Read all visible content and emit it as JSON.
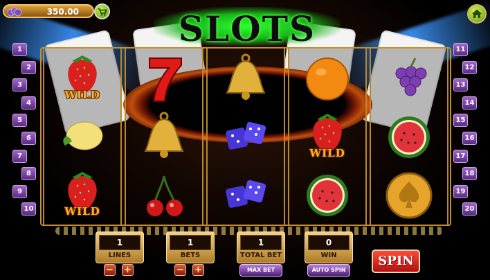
{
  "title": "SLOTS",
  "balance": {
    "coins": "350.00",
    "coin_icon": "coins-icon",
    "shop_icon": "cart-icon"
  },
  "home_icon": "home-icon",
  "line_buttons_left": [
    "1",
    "2",
    "3",
    "4",
    "5",
    "6",
    "7",
    "8",
    "9",
    "10"
  ],
  "line_buttons_right": [
    "11",
    "12",
    "13",
    "14",
    "15",
    "16",
    "17",
    "18",
    "19",
    "20"
  ],
  "reels": [
    [
      {
        "symbol": "strawberry",
        "wild": "WILD"
      },
      {
        "symbol": "lemon",
        "wild": ""
      },
      {
        "symbol": "strawberry",
        "wild": "WILD"
      }
    ],
    [
      {
        "symbol": "seven",
        "wild": ""
      },
      {
        "symbol": "bell",
        "wild": ""
      },
      {
        "symbol": "cherries",
        "wild": ""
      }
    ],
    [
      {
        "symbol": "bell",
        "wild": ""
      },
      {
        "symbol": "dice",
        "wild": ""
      },
      {
        "symbol": "dice",
        "wild": ""
      }
    ],
    [
      {
        "symbol": "orange",
        "wild": ""
      },
      {
        "symbol": "strawberry",
        "wild": "WILD"
      },
      {
        "symbol": "watermelon",
        "wild": ""
      }
    ],
    [
      {
        "symbol": "grapes",
        "wild": ""
      },
      {
        "symbol": "watermelon",
        "wild": ""
      },
      {
        "symbol": "spade-coin",
        "wild": ""
      }
    ]
  ],
  "controls": {
    "lines": {
      "value": "1",
      "label": "LINES"
    },
    "bets": {
      "value": "1",
      "label": "BETS"
    },
    "total_bet": {
      "value": "1",
      "label": "TOTAL BET"
    },
    "win": {
      "value": "0",
      "label": "WIN"
    },
    "minus": "−",
    "plus": "+",
    "max_bet": "MAX BET",
    "auto_spin": "AUTO SPIN",
    "spin": "SPIN"
  },
  "colors": {
    "title_glow": "#2cff2c",
    "gold": "#c98e2a",
    "line_button": "#7a3fa8",
    "spin": "#d61f14"
  }
}
